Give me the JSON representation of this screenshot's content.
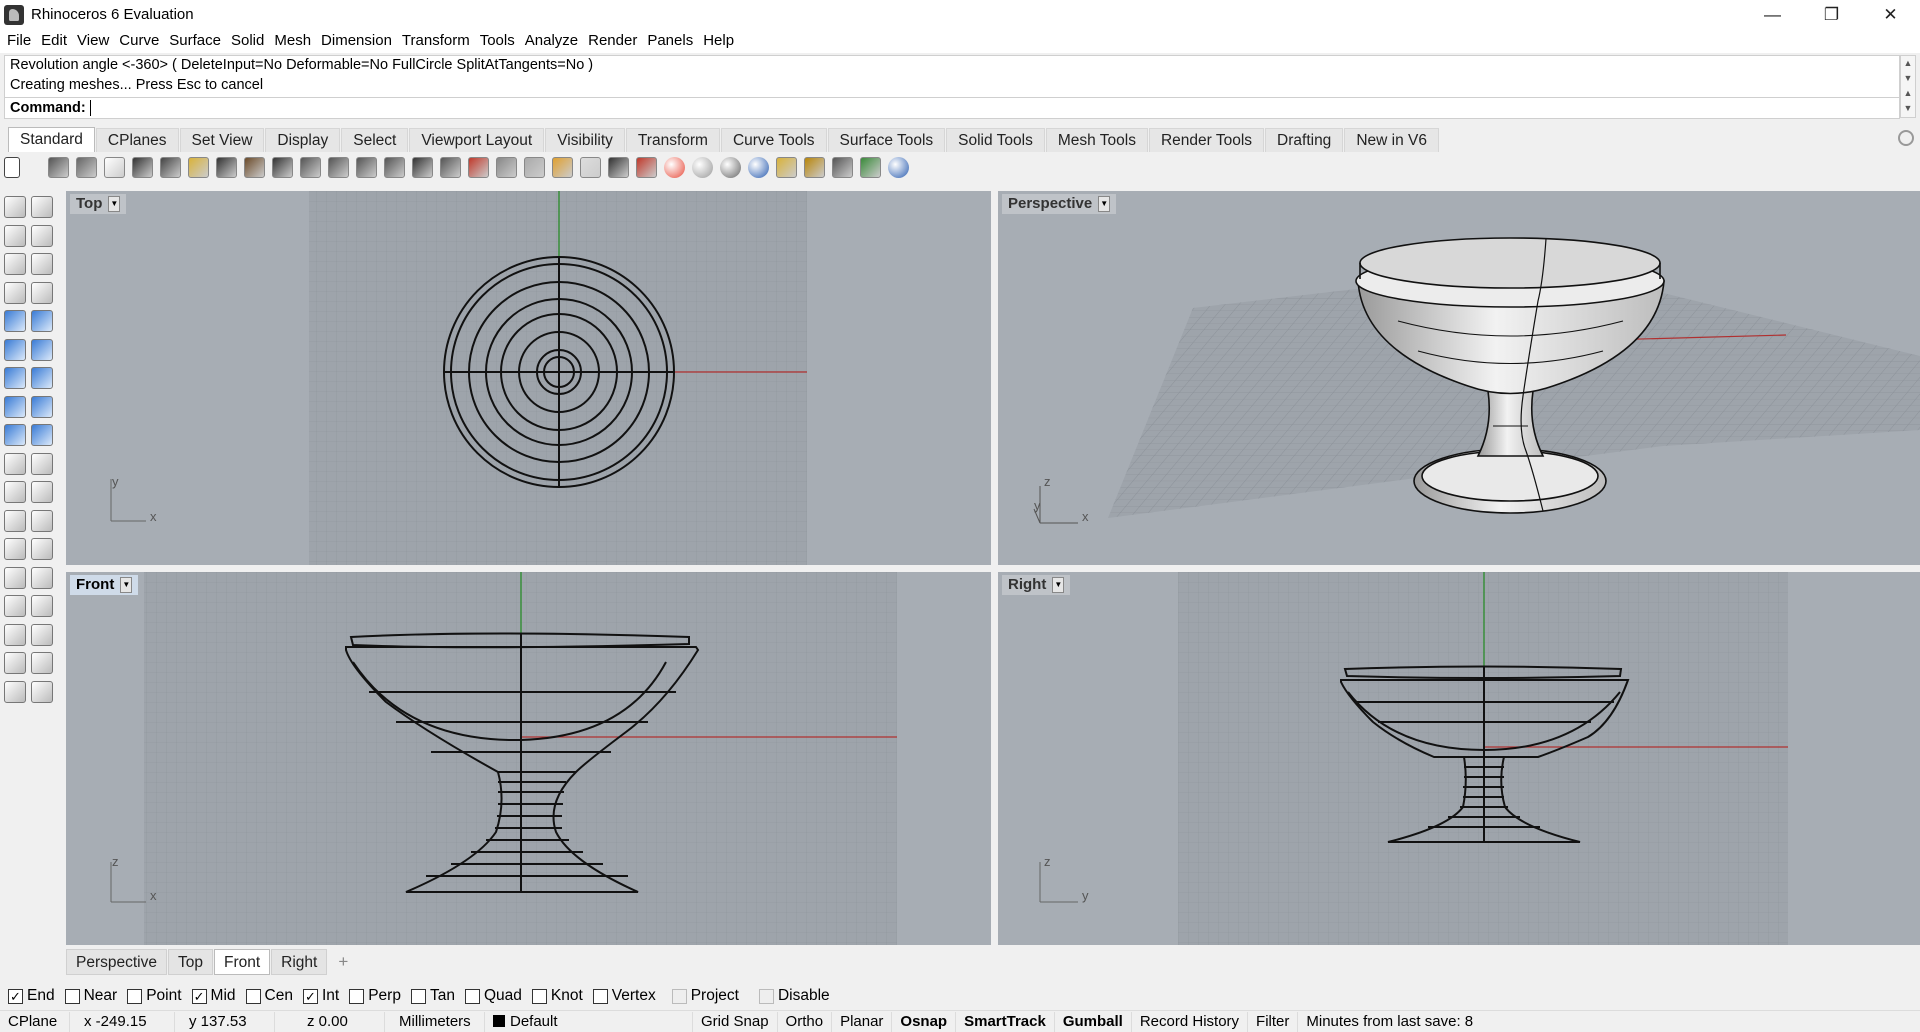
{
  "window": {
    "title": "Rhinoceros 6 Evaluation",
    "minimize": "—",
    "maximize": "❐",
    "close": "✕"
  },
  "menu": [
    "File",
    "Edit",
    "View",
    "Curve",
    "Surface",
    "Solid",
    "Mesh",
    "Dimension",
    "Transform",
    "Tools",
    "Analyze",
    "Render",
    "Panels",
    "Help"
  ],
  "command": {
    "history": [
      "Revolution angle <-360> ( DeleteInput=No  Deformable=No  FullCircle  SplitAtTangents=No )",
      "Creating meshes... Press Esc to cancel"
    ],
    "prompt": "Command:",
    "value": ""
  },
  "toolbar_tabs": [
    "Standard",
    "CPlanes",
    "Set View",
    "Display",
    "Select",
    "Viewport Layout",
    "Visibility",
    "Transform",
    "Curve Tools",
    "Surface Tools",
    "Solid Tools",
    "Mesh Tools",
    "Render Tools",
    "Drafting",
    "New in V6"
  ],
  "toolbar_icons": [
    "new-icon",
    "save-icon",
    "print-icon",
    "import-icon",
    "cut-icon",
    "copy-icon",
    "paste-icon",
    "undo-icon",
    "pan-icon",
    "rotate-view-icon",
    "zoom-icon",
    "zoom-window-icon",
    "zoom-extents-icon",
    "zoom-selected-icon",
    "undo-view-icon",
    "four-viewports-icon",
    "car-icon",
    "properties-icon",
    "cplane-icon",
    "osnap-icon",
    "light-icon",
    "lock-icon",
    "layer-icon",
    "color-wheel-icon",
    "render-sphere-icon",
    "shaded-sphere-icon",
    "material-sphere-icon",
    "flamingo-icon",
    "options-gear-icon",
    "grid-options-icon",
    "render-icon",
    "help-icon"
  ],
  "viewports": {
    "top": {
      "label": "Top",
      "axis1": "y",
      "axis2": "x"
    },
    "perspective": {
      "label": "Perspective",
      "axis1": "z",
      "axis2": "y",
      "axis3": "x"
    },
    "front": {
      "label": "Front",
      "axis1": "z",
      "axis2": "x"
    },
    "right": {
      "label": "Right",
      "axis1": "z",
      "axis2": "y"
    }
  },
  "viewport_tabs": [
    "Perspective",
    "Top",
    "Front",
    "Right"
  ],
  "viewport_tab_add": "+",
  "osnaps": [
    {
      "label": "End",
      "checked": true
    },
    {
      "label": "Near",
      "checked": false
    },
    {
      "label": "Point",
      "checked": false
    },
    {
      "label": "Mid",
      "checked": true
    },
    {
      "label": "Cen",
      "checked": false
    },
    {
      "label": "Int",
      "checked": true
    },
    {
      "label": "Perp",
      "checked": false
    },
    {
      "label": "Tan",
      "checked": false
    },
    {
      "label": "Quad",
      "checked": false
    },
    {
      "label": "Knot",
      "checked": false
    },
    {
      "label": "Vertex",
      "checked": false
    },
    {
      "label": "Project",
      "checked": false,
      "disabled": true
    },
    {
      "label": "Disable",
      "checked": false,
      "disabled": true
    }
  ],
  "status": {
    "cplane": "CPlane",
    "x": "x -249.15",
    "y": "y 137.53",
    "z": "z 0.00",
    "units": "Millimeters",
    "layer": "Default",
    "grid_snap": "Grid Snap",
    "ortho": "Ortho",
    "planar": "Planar",
    "osnap": "Osnap",
    "smarttrack": "SmartTrack",
    "gumball": "Gumball",
    "record_history": "Record History",
    "filter": "Filter",
    "save_info": "Minutes from last save: 8"
  },
  "colors": {
    "viewport_bg": "#a7adb4",
    "grid_bg": "#9aa1a8",
    "grid_line": "#8a9098",
    "x_axis": "#b03030",
    "y_axis": "#1f8a1f",
    "active_label": "#cfdbe9"
  }
}
